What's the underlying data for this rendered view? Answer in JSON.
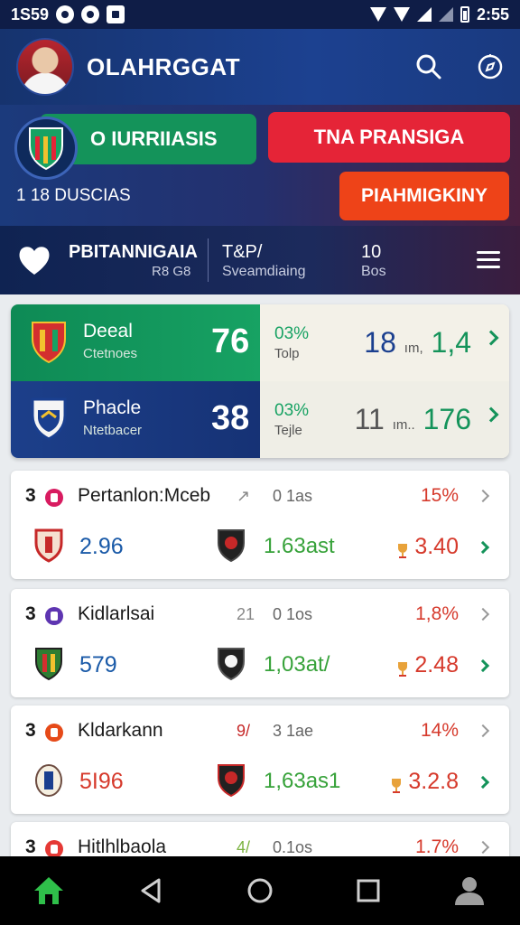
{
  "status_bar": {
    "time": "1S59",
    "clock": "2:55"
  },
  "header": {
    "title": "OLAHRGGAT"
  },
  "promo": {
    "green_button": "O IURRIIASIS",
    "red_button": "TNA PRANSIGA",
    "orange_button": "PIAHMIGKINY",
    "subtitle": "1 18 DUSCIAS"
  },
  "league": {
    "name": "PBITANNIGAIA",
    "code": "R8 G8",
    "col2_top": "T&P/",
    "col2_bottom": "Sveamdiaing",
    "col3_top": "10",
    "col3_bottom": "Bos"
  },
  "featured": [
    {
      "name": "Deeal",
      "sub": "Ctetnoes",
      "score": "76",
      "pct": "03%",
      "tip": "Tolp",
      "val_main": "18",
      "val_mini": "ım,",
      "val_end": "1,4",
      "crest_color": "#d32f2f"
    },
    {
      "name": "Phacle",
      "sub": "Ntetbacer",
      "score": "38",
      "pct": "03%",
      "tip": "Tejle",
      "val_main": "11",
      "val_mini": "ım..",
      "val_end": "176",
      "crest_color": "#1a3f8f"
    }
  ],
  "matches": [
    {
      "num": "3",
      "dot_color": "#d81b60",
      "name": "Pertanlon:Mceb",
      "glyph": "↗",
      "glyph_color": "#888",
      "time": "0 1as",
      "pct": "15%",
      "v1": "2.96",
      "v2": "1.63ast",
      "v3": "3.40",
      "crest1_color": "#c62828",
      "crest2_color": "#212121"
    },
    {
      "num": "3",
      "dot_color": "#5e35b1",
      "name": "Kidlarlsai",
      "glyph": "21",
      "glyph_color": "#888",
      "time": "0 1os",
      "pct": "1,8%",
      "v1": "579",
      "v2": "1,03at/",
      "v3": "2.48",
      "crest1_color": "#2e7d32",
      "crest2_color": "#212121"
    },
    {
      "num": "3",
      "dot_color": "#e64a19",
      "name": "Kldarkann",
      "glyph": "9/",
      "glyph_color": "#c62828",
      "time": "3 1ae",
      "pct": "14%",
      "v1": "5I96",
      "v2": "1,63as1",
      "v3": "3.2.8",
      "crest1_color": "#6d4c41",
      "crest2_color": "#212121"
    },
    {
      "num": "3",
      "dot_color": "#e53935",
      "name": "Hitlhlbaola",
      "glyph": "4/",
      "glyph_color": "#7cb342",
      "time": "0.1os",
      "pct": "1.7%",
      "v1": "",
      "v2": "",
      "v3": "",
      "crest1_color": "#c62828",
      "crest2_color": "#212121"
    }
  ],
  "colors": {
    "primary": "#1c4190",
    "green": "#14935a",
    "red": "#e52437",
    "orange": "#ee4318"
  }
}
